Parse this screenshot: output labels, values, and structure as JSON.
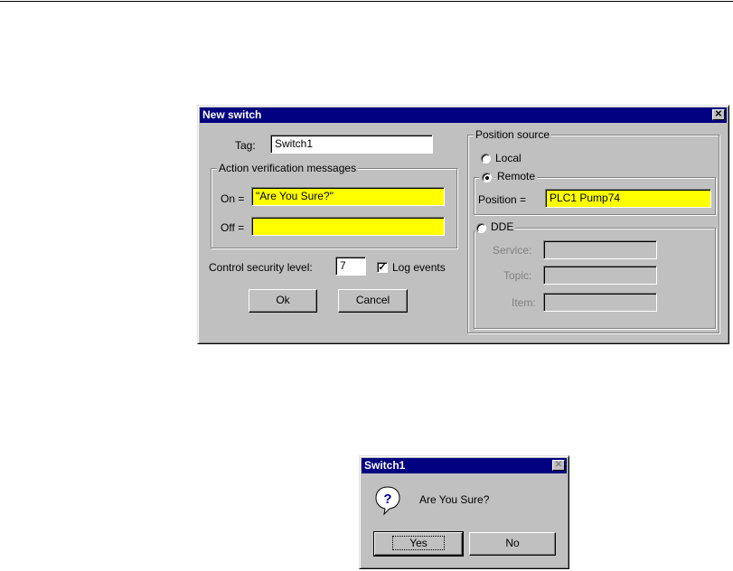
{
  "dialog1": {
    "title": "New switch",
    "tag_label": "Tag:",
    "tag_value": "Switch1",
    "action_group_title": "Action verification messages",
    "on_label": "On =",
    "on_value": "\"Are You Sure?\"",
    "off_label": "Off =",
    "off_value": "",
    "security_label": "Control security level:",
    "security_value": "7",
    "log_events_label": "Log events",
    "log_events_checked": true,
    "ok_label": "Ok",
    "cancel_label": "Cancel",
    "position_source_title": "Position source",
    "local_label": "Local",
    "remote_label": "Remote",
    "selected_source": "Remote",
    "position_label": "Position =",
    "position_value": "PLC1 Pump74",
    "dde_label": "DDE",
    "service_label": "Service:",
    "topic_label": "Topic:",
    "item_label": "Item:",
    "close_glyph": "✕"
  },
  "dialog2": {
    "title": "Switch1",
    "message": "Are You Sure?",
    "yes_label": "Yes",
    "no_label": "No",
    "icon": "question-icon",
    "close_glyph": "✕"
  },
  "colors": {
    "title_bar": "#000080",
    "dialog_face": "#c0c0c0",
    "highlight_field": "#ffff00"
  }
}
